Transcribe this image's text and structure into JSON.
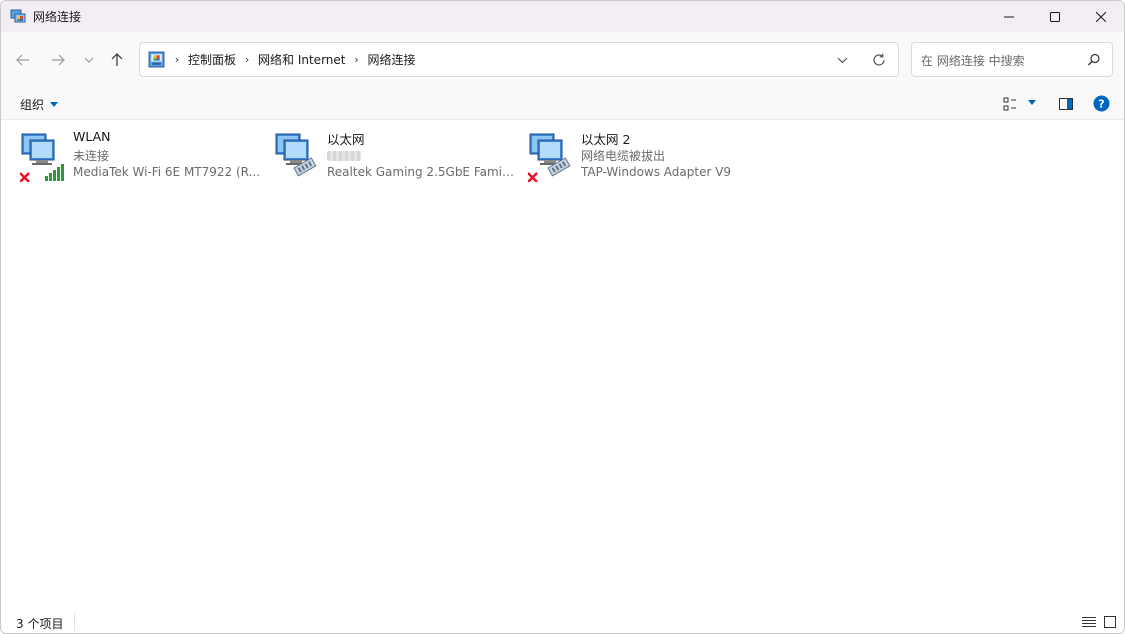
{
  "window": {
    "title": "网络连接",
    "icon": "network-connections-icon"
  },
  "nav": {
    "back": "arrow-left-icon",
    "forward": "arrow-right-icon",
    "recent": "chevron-down-icon",
    "up": "arrow-up-icon"
  },
  "address": {
    "crumbs": [
      "控制面板",
      "网络和 Internet",
      "网络连接"
    ]
  },
  "search": {
    "placeholder": "在 网络连接 中搜索"
  },
  "toolbar": {
    "organize_label": "组织"
  },
  "connections": [
    {
      "name": "WLAN",
      "status": "未连接",
      "adapter": "MediaTek Wi-Fi 6E MT7922 (R...",
      "type": "wifi",
      "disconnected": true
    },
    {
      "name": "以太网",
      "status": "",
      "adapter": "Realtek Gaming 2.5GbE Family...",
      "type": "ethernet",
      "disconnected": false
    },
    {
      "name": "以太网 2",
      "status": "网络电缆被拔出",
      "adapter": "TAP-Windows Adapter V9",
      "type": "ethernet",
      "disconnected": true
    }
  ],
  "statusbar": {
    "count": "3 个项目"
  },
  "colors": {
    "titlebar": "#f3eef3",
    "accent": "#0067c0",
    "error_red": "#e81123",
    "signal_green": "#2e9b3a"
  }
}
